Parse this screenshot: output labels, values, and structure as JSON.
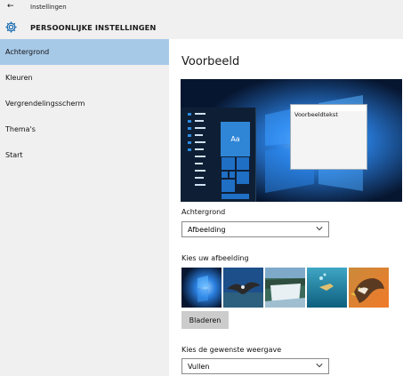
{
  "window": {
    "title": "Instellingen"
  },
  "header": {
    "title": "PERSOONLIJKE INSTELLINGEN"
  },
  "sidebar": {
    "items": [
      {
        "label": "Achtergrond",
        "selected": true
      },
      {
        "label": "Kleuren",
        "selected": false
      },
      {
        "label": "Vergrendelingsscherm",
        "selected": false
      },
      {
        "label": "Thema's",
        "selected": false
      },
      {
        "label": "Start",
        "selected": false
      }
    ]
  },
  "main": {
    "title": "Voorbeeld",
    "preview": {
      "sample_text": "Voorbeeldtekst",
      "tile_text": "Aa"
    },
    "background": {
      "label": "Achtergrond",
      "value": "Afbeelding"
    },
    "pictures": {
      "label": "Kies uw afbeelding",
      "browse_label": "Bladeren"
    },
    "fit": {
      "label": "Kies de gewenste weergave",
      "value": "Vullen"
    }
  },
  "colors": {
    "selected_nav": "#a7c9e8",
    "sidebar_bg": "#f0f0f0",
    "accent": "#2f86d7"
  }
}
